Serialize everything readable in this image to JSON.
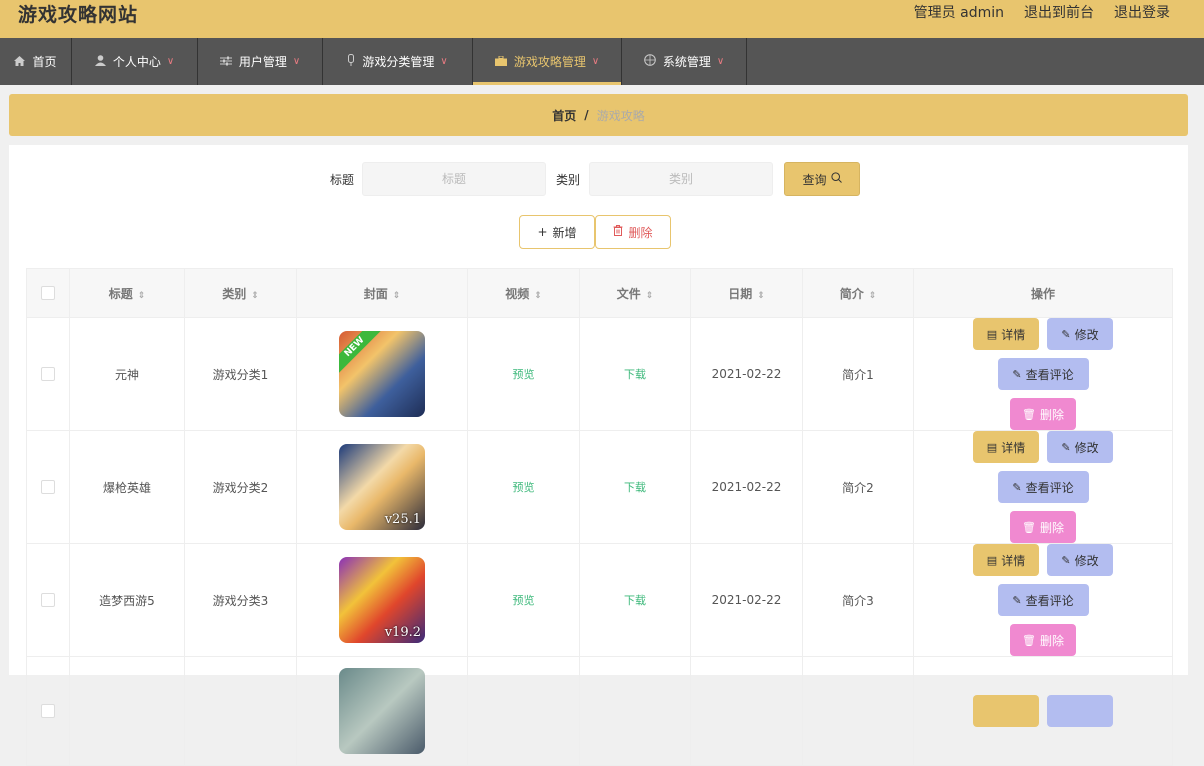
{
  "header": {
    "site_title": "游戏攻略网站",
    "admin_label": "管理员 admin",
    "front_label": "退出到前台",
    "logout_label": "退出登录"
  },
  "nav": {
    "items": [
      {
        "label": "首页",
        "icon": "home-icon"
      },
      {
        "label": "个人中心",
        "icon": "user-icon"
      },
      {
        "label": "用户管理",
        "icon": "sliders-icon"
      },
      {
        "label": "游戏分类管理",
        "icon": "mic-icon"
      },
      {
        "label": "游戏攻略管理",
        "icon": "briefcase-icon"
      },
      {
        "label": "系统管理",
        "icon": "compass-icon"
      }
    ]
  },
  "breadcrumb": {
    "home": "首页",
    "sep": "/",
    "current": "游戏攻略"
  },
  "search": {
    "title_label": "标题",
    "title_placeholder": "标题",
    "category_label": "类别",
    "category_placeholder": "类别",
    "query_label": "查询",
    "add_label": "新增",
    "delete_label": "删除"
  },
  "table": {
    "columns": [
      "标题",
      "类别",
      "封面",
      "视频",
      "文件",
      "日期",
      "简介",
      "操作"
    ],
    "rows": [
      {
        "title": "元神",
        "category": "游戏分类1",
        "cover_tag": "NEW",
        "cover_version": "",
        "video": "预览",
        "file": "下载",
        "date": "2021-02-22",
        "intro": "简介1"
      },
      {
        "title": "爆枪英雄",
        "category": "游戏分类2",
        "cover_tag": "",
        "cover_version": "v25.1",
        "video": "预览",
        "file": "下载",
        "date": "2021-02-22",
        "intro": "简介2"
      },
      {
        "title": "造梦西游5",
        "category": "游戏分类3",
        "cover_tag": "",
        "cover_version": "v19.2",
        "video": "预览",
        "file": "下载",
        "date": "2021-02-22",
        "intro": "简介3"
      }
    ],
    "actions": {
      "detail": "详情",
      "edit": "修改",
      "comment": "查看评论",
      "delete": "删除"
    }
  },
  "colors": {
    "accent": "#e8c56e",
    "nav_bg": "#555555",
    "action_blue": "#b3bdf0",
    "action_pink": "#f089d0",
    "link_green": "#3cb87a"
  }
}
